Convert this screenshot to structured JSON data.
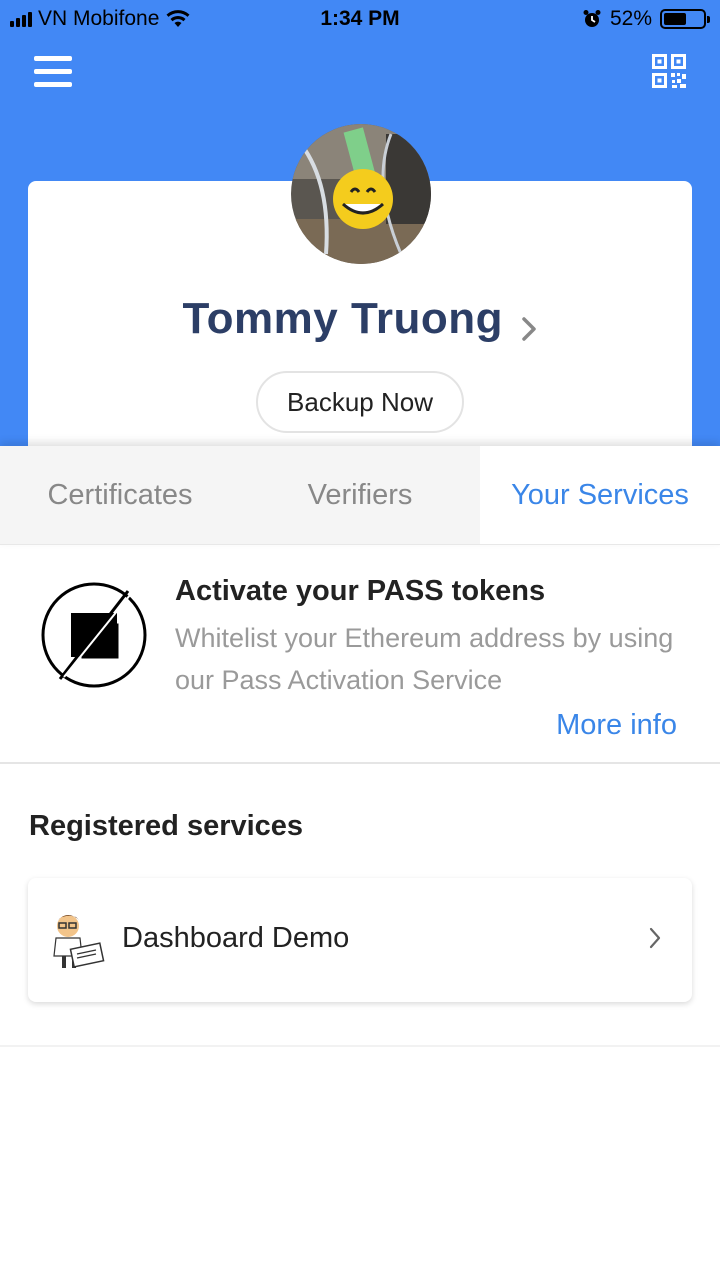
{
  "status_bar": {
    "carrier": "VN Mobifone",
    "time": "1:34 PM",
    "battery_percent": "52%",
    "battery_level": 0.52
  },
  "header": {
    "menu_icon": "hamburger-menu-icon",
    "qr_icon": "qr-code-icon"
  },
  "profile": {
    "name": "Tommy Truong",
    "backup_label": "Backup Now"
  },
  "tabs": [
    {
      "label": "Certificates",
      "active": false
    },
    {
      "label": "Verifiers",
      "active": false
    },
    {
      "label": "Your Services",
      "active": true
    }
  ],
  "activate": {
    "title": "Activate your PASS tokens",
    "description": "Whitelist your Ethereum address by using our Pass Activation Service",
    "more_info": "More info"
  },
  "registered": {
    "title": "Registered services",
    "services": [
      {
        "name": "Dashboard Demo"
      }
    ]
  },
  "colors": {
    "accent": "#4288f5",
    "link": "#3a86e8",
    "name": "#2c3e66"
  }
}
